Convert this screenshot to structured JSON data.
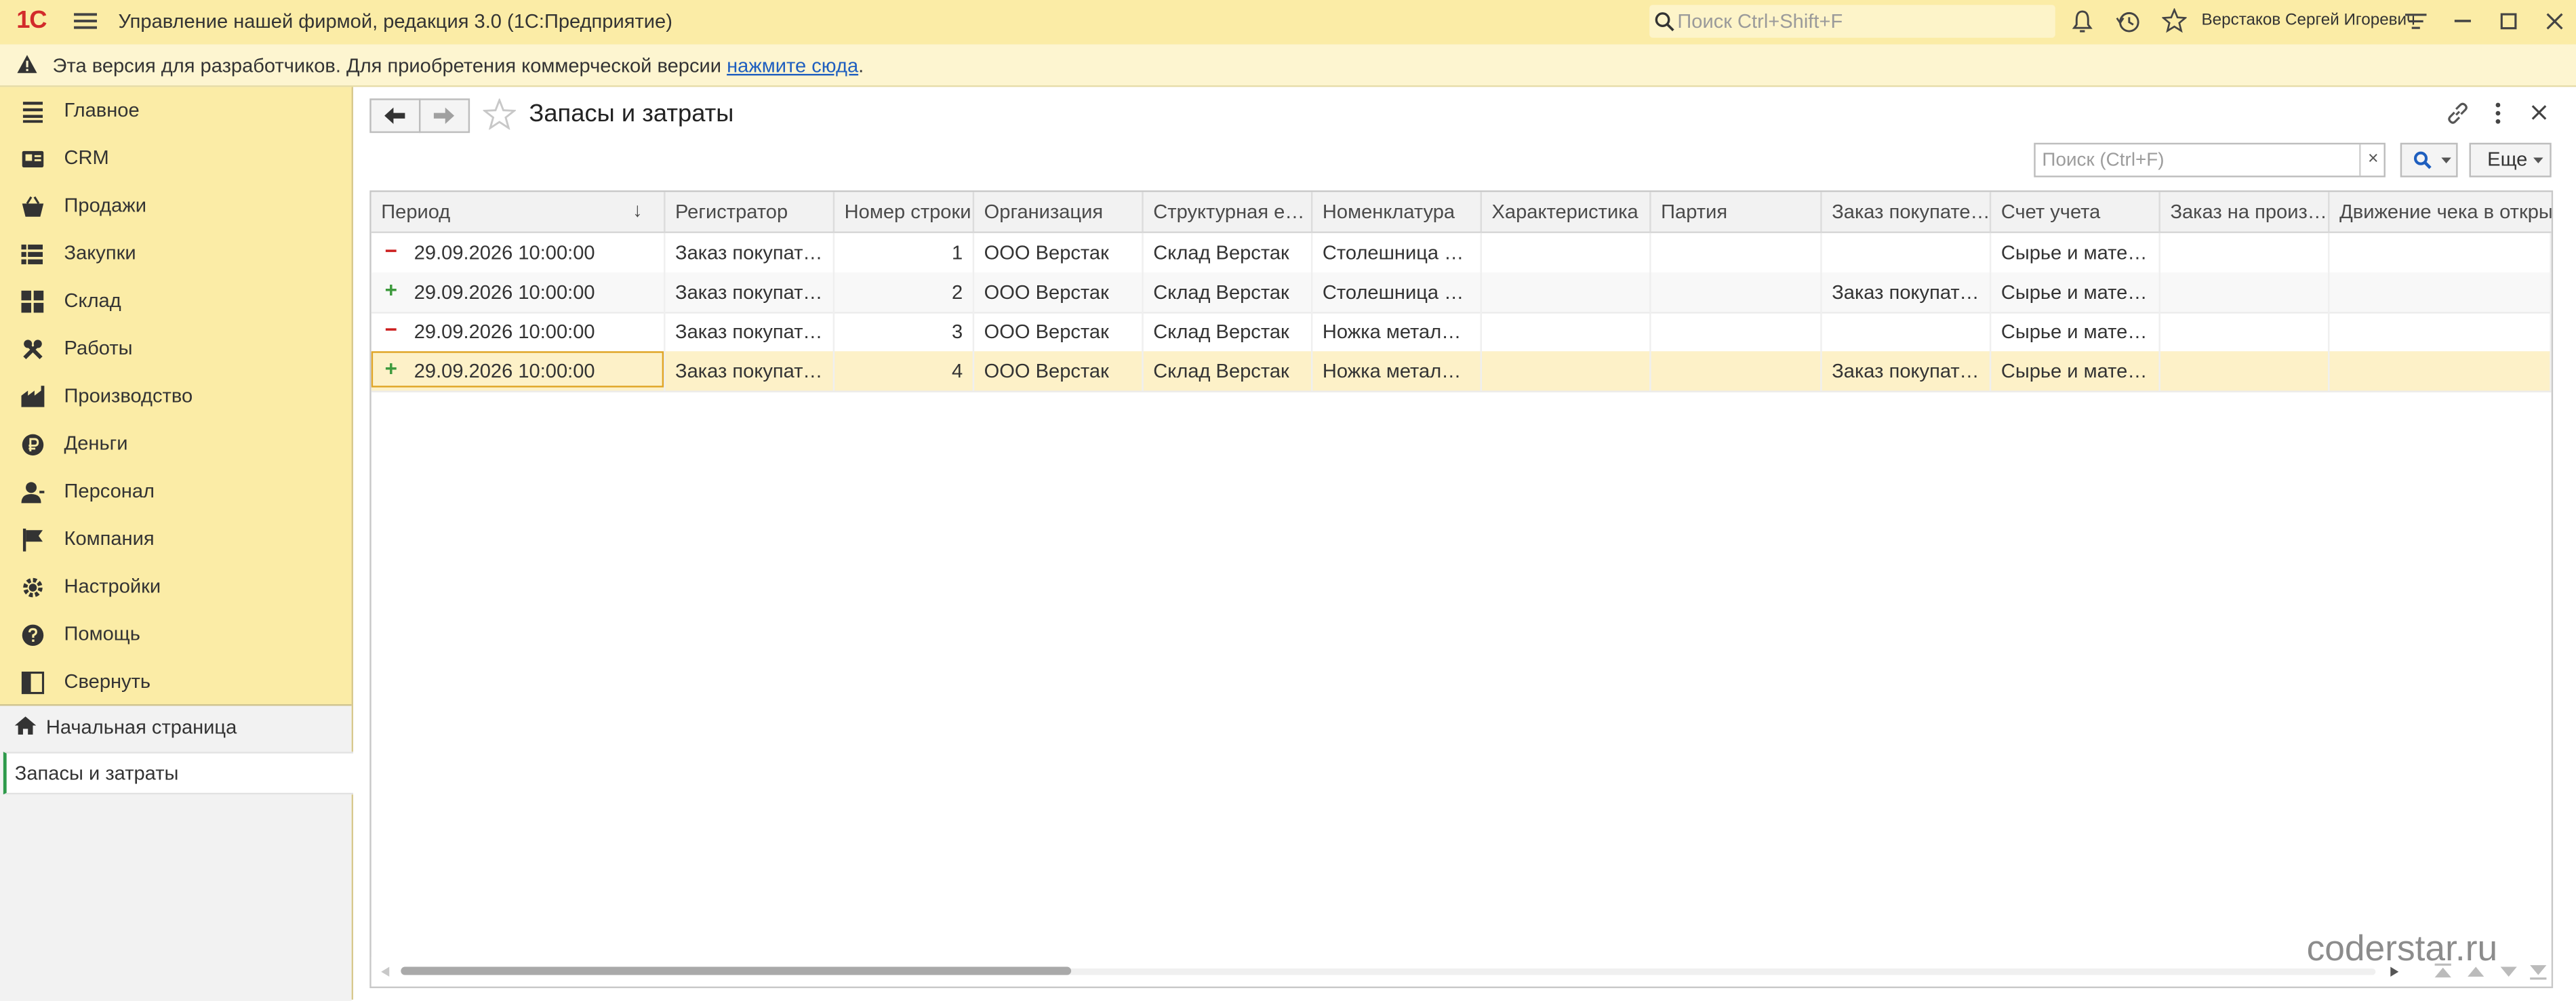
{
  "app": {
    "logo": "1С",
    "title": "Управление нашей фирмой, редакция 3.0  (1С:Предприятие)",
    "search_placeholder": "Поиск Ctrl+Shift+F",
    "user": "Верстаков Сергей Игоревич"
  },
  "notice": {
    "text": "Эта версия для разработчиков. Для приобретения коммерческой версии ",
    "link": "нажмите сюда",
    "tail": "."
  },
  "sidebar": {
    "items": [
      {
        "label": "Главное",
        "icon": "menu-lines-icon"
      },
      {
        "label": "CRM",
        "icon": "crm-icon"
      },
      {
        "label": "Продажи",
        "icon": "basket-icon"
      },
      {
        "label": "Закупки",
        "icon": "cart-icon"
      },
      {
        "label": "Склад",
        "icon": "warehouse-icon"
      },
      {
        "label": "Работы",
        "icon": "tools-icon"
      },
      {
        "label": "Производство",
        "icon": "factory-icon"
      },
      {
        "label": "Деньги",
        "icon": "ruble-icon"
      },
      {
        "label": "Персонал",
        "icon": "person-icon"
      },
      {
        "label": "Компания",
        "icon": "flag-icon"
      },
      {
        "label": "Настройки",
        "icon": "gear-icon"
      },
      {
        "label": "Помощь",
        "icon": "help-icon"
      },
      {
        "label": "Свернуть",
        "icon": "collapse-icon"
      }
    ],
    "home": "Начальная страница",
    "open_tab": "Запасы и затраты"
  },
  "form": {
    "title": "Запасы и затраты",
    "search_placeholder": "Поиск (Ctrl+F)",
    "search_clear": "×",
    "more_label": "Еще"
  },
  "table": {
    "columns": [
      "Период",
      "Регистратор",
      "Номер строки",
      "Организация",
      "Структурная е…",
      "Номенклатура",
      "Характеристика",
      "Партия",
      "Заказ покупате…",
      "Счет учета",
      "Заказ на произ…",
      "Движение чека в открыто…"
    ],
    "sort_indicator": "↓",
    "rows": [
      {
        "sign": "−",
        "type": "minus",
        "cells": [
          "29.09.2026 10:00:00",
          "Заказ покупате…",
          "1",
          "ООО Верстак",
          "Склад Верстак",
          "Столешница д…",
          "",
          "",
          "",
          "Сырье и матер…",
          "",
          ""
        ]
      },
      {
        "sign": "+",
        "type": "plus",
        "cells": [
          "29.09.2026 10:00:00",
          "Заказ покупате…",
          "2",
          "ООО Верстак",
          "Склад Верстак",
          "Столешница д…",
          "",
          "",
          "Заказ покупате…",
          "Сырье и матер…",
          "",
          ""
        ]
      },
      {
        "sign": "−",
        "type": "minus",
        "cells": [
          "29.09.2026 10:00:00",
          "Заказ покупате…",
          "3",
          "ООО Верстак",
          "Склад Верстак",
          "Ножка металл…",
          "",
          "",
          "",
          "Сырье и матер…",
          "",
          ""
        ]
      },
      {
        "sign": "+",
        "type": "plus",
        "cells": [
          "29.09.2026 10:00:00",
          "Заказ покупате…",
          "4",
          "ООО Верстак",
          "Склад Верстак",
          "Ножка металл…",
          "",
          "",
          "Заказ покупате…",
          "Сырье и матер…",
          "",
          ""
        ]
      }
    ],
    "selected_row": 3
  },
  "watermark": "coderstar.ru",
  "colors": {
    "accent": "#fbeca6",
    "selection": "#fdf1c8",
    "minus": "#cc1f1f",
    "plus": "#3d9a3d"
  }
}
